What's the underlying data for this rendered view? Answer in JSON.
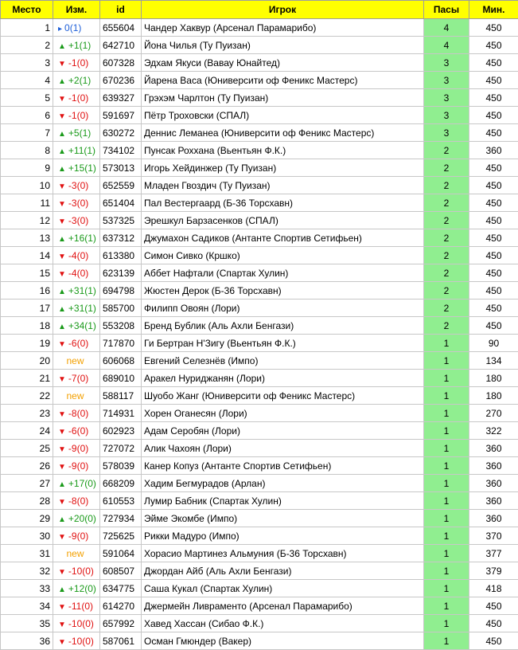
{
  "headers": {
    "rank": "Место",
    "change": "Изм.",
    "id": "id",
    "player": "Игрок",
    "passes": "Пасы",
    "minutes": "Мин."
  },
  "colors": {
    "header_bg": "#ffff00",
    "passes_bg": "#90ee90",
    "up": "#1a9a1a",
    "down": "#e01010",
    "same": "#1e5fd8",
    "new": "#f3a000"
  },
  "rows": [
    {
      "rank": "1",
      "dir": "same",
      "change": "0(1)",
      "id": "655604",
      "player": "Чандер Хаквур (Арсенал Парамарибо)",
      "passes": "4",
      "minutes": "450"
    },
    {
      "rank": "2",
      "dir": "up",
      "change": "+1(1)",
      "id": "642710",
      "player": "Йона Чилья (Ту Пуизан)",
      "passes": "4",
      "minutes": "450"
    },
    {
      "rank": "3",
      "dir": "down",
      "change": "-1(0)",
      "id": "607328",
      "player": "Эдхам Якуси (Вавау Юнайтед)",
      "passes": "3",
      "minutes": "450"
    },
    {
      "rank": "4",
      "dir": "up",
      "change": "+2(1)",
      "id": "670236",
      "player": "Йарена Васа (Юниверсити оф Феникс Мастерс)",
      "passes": "3",
      "minutes": "450"
    },
    {
      "rank": "5",
      "dir": "down",
      "change": "-1(0)",
      "id": "639327",
      "player": "Грэхэм Чарлтон (Ту Пуизан)",
      "passes": "3",
      "minutes": "450"
    },
    {
      "rank": "6",
      "dir": "down",
      "change": "-1(0)",
      "id": "591697",
      "player": "Пётр Троховски (СПАЛ)",
      "passes": "3",
      "minutes": "450"
    },
    {
      "rank": "7",
      "dir": "up",
      "change": "+5(1)",
      "id": "630272",
      "player": "Деннис Леманеа (Юниверсити оф Феникс Мастерс)",
      "passes": "3",
      "minutes": "450"
    },
    {
      "rank": "8",
      "dir": "up",
      "change": "+11(1)",
      "id": "734102",
      "player": "Пунсак Роххана (Вьентьян Ф.К.)",
      "passes": "2",
      "minutes": "360"
    },
    {
      "rank": "9",
      "dir": "up",
      "change": "+15(1)",
      "id": "573013",
      "player": "Игорь Хейдинжер (Ту Пуизан)",
      "passes": "2",
      "minutes": "450"
    },
    {
      "rank": "10",
      "dir": "down",
      "change": "-3(0)",
      "id": "652559",
      "player": "Младен Гвоздич (Ту Пуизан)",
      "passes": "2",
      "minutes": "450"
    },
    {
      "rank": "11",
      "dir": "down",
      "change": "-3(0)",
      "id": "651404",
      "player": "Пал Вестергаард (Б-36 Торсхавн)",
      "passes": "2",
      "minutes": "450"
    },
    {
      "rank": "12",
      "dir": "down",
      "change": "-3(0)",
      "id": "537325",
      "player": "Эрешкул Барзасенков (СПАЛ)",
      "passes": "2",
      "minutes": "450"
    },
    {
      "rank": "13",
      "dir": "up",
      "change": "+16(1)",
      "id": "637312",
      "player": "Джумахон Садиков (Антанте Спортив Сетифьен)",
      "passes": "2",
      "minutes": "450"
    },
    {
      "rank": "14",
      "dir": "down",
      "change": "-4(0)",
      "id": "613380",
      "player": "Симон Сивко (Кршко)",
      "passes": "2",
      "minutes": "450"
    },
    {
      "rank": "15",
      "dir": "down",
      "change": "-4(0)",
      "id": "623139",
      "player": "Аббет Нафтали (Спартак Хулин)",
      "passes": "2",
      "minutes": "450"
    },
    {
      "rank": "16",
      "dir": "up",
      "change": "+31(1)",
      "id": "694798",
      "player": "Жюстен Дерок (Б-36 Торсхавн)",
      "passes": "2",
      "minutes": "450"
    },
    {
      "rank": "17",
      "dir": "up",
      "change": "+31(1)",
      "id": "585700",
      "player": "Филипп Овоян (Лори)",
      "passes": "2",
      "minutes": "450"
    },
    {
      "rank": "18",
      "dir": "up",
      "change": "+34(1)",
      "id": "553208",
      "player": "Бренд Бублик (Аль Ахли Бенгази)",
      "passes": "2",
      "minutes": "450"
    },
    {
      "rank": "19",
      "dir": "down",
      "change": "-6(0)",
      "id": "717870",
      "player": "Ги Бертран Н'Зигу (Вьентьян Ф.К.)",
      "passes": "1",
      "minutes": "90"
    },
    {
      "rank": "20",
      "dir": "new",
      "change": "new",
      "id": "606068",
      "player": "Евгений Селезнёв (Импо)",
      "passes": "1",
      "minutes": "134"
    },
    {
      "rank": "21",
      "dir": "down",
      "change": "-7(0)",
      "id": "689010",
      "player": "Аракел Нуриджанян (Лори)",
      "passes": "1",
      "minutes": "180"
    },
    {
      "rank": "22",
      "dir": "new",
      "change": "new",
      "id": "588117",
      "player": "Шуобо Жанг (Юниверсити оф Феникс Мастерс)",
      "passes": "1",
      "minutes": "180"
    },
    {
      "rank": "23",
      "dir": "down",
      "change": "-8(0)",
      "id": "714931",
      "player": "Хорен Оганесян (Лори)",
      "passes": "1",
      "minutes": "270"
    },
    {
      "rank": "24",
      "dir": "down",
      "change": "-6(0)",
      "id": "602923",
      "player": "Адам Серобян (Лори)",
      "passes": "1",
      "minutes": "322"
    },
    {
      "rank": "25",
      "dir": "down",
      "change": "-9(0)",
      "id": "727072",
      "player": "Алик Чахоян (Лори)",
      "passes": "1",
      "minutes": "360"
    },
    {
      "rank": "26",
      "dir": "down",
      "change": "-9(0)",
      "id": "578039",
      "player": "Канер Копуз (Антанте Спортив Сетифьен)",
      "passes": "1",
      "minutes": "360"
    },
    {
      "rank": "27",
      "dir": "up",
      "change": "+17(0)",
      "id": "668209",
      "player": "Хадим Бегмурадов (Арлан)",
      "passes": "1",
      "minutes": "360"
    },
    {
      "rank": "28",
      "dir": "down",
      "change": "-8(0)",
      "id": "610553",
      "player": "Лумир Бабник (Спартак Хулин)",
      "passes": "1",
      "minutes": "360"
    },
    {
      "rank": "29",
      "dir": "up",
      "change": "+20(0)",
      "id": "727934",
      "player": "Эйме Экомбе (Импо)",
      "passes": "1",
      "minutes": "360"
    },
    {
      "rank": "30",
      "dir": "down",
      "change": "-9(0)",
      "id": "725625",
      "player": "Рикки Мадуро (Импо)",
      "passes": "1",
      "minutes": "370"
    },
    {
      "rank": "31",
      "dir": "new",
      "change": "new",
      "id": "591064",
      "player": "Хорасио Мартинез Альмуния (Б-36 Торсхавн)",
      "passes": "1",
      "minutes": "377"
    },
    {
      "rank": "32",
      "dir": "down",
      "change": "-10(0)",
      "id": "608507",
      "player": "Джордан Айб (Аль Ахли Бенгази)",
      "passes": "1",
      "minutes": "379"
    },
    {
      "rank": "33",
      "dir": "up",
      "change": "+12(0)",
      "id": "634775",
      "player": "Саша Кукал (Спартак Хулин)",
      "passes": "1",
      "minutes": "418"
    },
    {
      "rank": "34",
      "dir": "down",
      "change": "-11(0)",
      "id": "614270",
      "player": "Джермейн Ливраменто (Арсенал Парамарибо)",
      "passes": "1",
      "minutes": "450"
    },
    {
      "rank": "35",
      "dir": "down",
      "change": "-10(0)",
      "id": "657992",
      "player": "Хавед Хассан (Сибао Ф.К.)",
      "passes": "1",
      "minutes": "450"
    },
    {
      "rank": "36",
      "dir": "down",
      "change": "-10(0)",
      "id": "587061",
      "player": "Осман Гмюндер (Вакер)",
      "passes": "1",
      "minutes": "450"
    }
  ]
}
